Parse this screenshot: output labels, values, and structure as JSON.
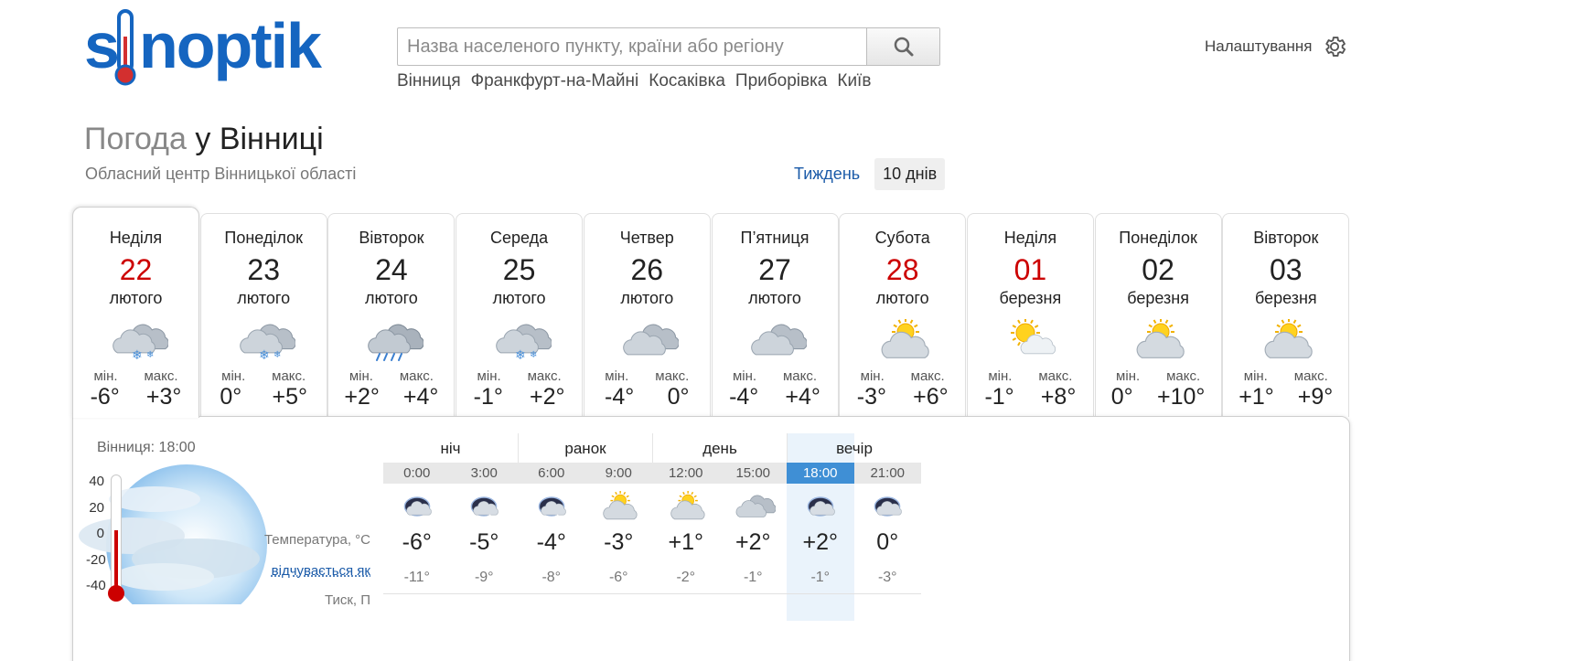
{
  "logo": {
    "text": "sinoptik"
  },
  "search": {
    "placeholder": "Назва населеного пункту, країни або регіону"
  },
  "quick_links": [
    "Вінниця",
    "Франкфурт-на-Майні",
    "Косаківка",
    "Приборівка",
    "Київ"
  ],
  "settings": {
    "label": "Налаштування"
  },
  "header": {
    "title_prefix": "Погода",
    "title_city": "у Вінниці",
    "subtitle": "Обласний центр Вінницької області"
  },
  "period": {
    "week": "Тиждень",
    "ten_days": "10 днів"
  },
  "labels": {
    "min": "мін.",
    "max": "макс."
  },
  "days": [
    {
      "name": "Неділя",
      "date": "22",
      "month": "лютого",
      "red": true,
      "icon": "cloud-snow-icon",
      "min": "-6°",
      "max": "+3°",
      "active": true
    },
    {
      "name": "Понеділок",
      "date": "23",
      "month": "лютого",
      "red": false,
      "icon": "cloud-snow-icon",
      "min": "0°",
      "max": "+5°"
    },
    {
      "name": "Вівторок",
      "date": "24",
      "month": "лютого",
      "red": false,
      "icon": "cloud-rain-icon",
      "min": "+2°",
      "max": "+4°"
    },
    {
      "name": "Середа",
      "date": "25",
      "month": "лютого",
      "red": false,
      "icon": "cloud-snow-icon",
      "min": "-1°",
      "max": "+2°"
    },
    {
      "name": "Четвер",
      "date": "26",
      "month": "лютого",
      "red": false,
      "icon": "cloud-icon",
      "min": "-4°",
      "max": "0°"
    },
    {
      "name": "П’ятниця",
      "date": "27",
      "month": "лютого",
      "red": false,
      "icon": "cloud-icon",
      "min": "-4°",
      "max": "+4°"
    },
    {
      "name": "Субота",
      "date": "28",
      "month": "лютого",
      "red": true,
      "icon": "sun-cloud-icon",
      "min": "-3°",
      "max": "+6°"
    },
    {
      "name": "Неділя",
      "date": "01",
      "month": "березня",
      "red": true,
      "icon": "sun-light-cloud-icon",
      "min": "-1°",
      "max": "+8°"
    },
    {
      "name": "Понеділок",
      "date": "02",
      "month": "березня",
      "red": false,
      "icon": "sun-cloud-icon",
      "min": "0°",
      "max": "+10°"
    },
    {
      "name": "Вівторок",
      "date": "03",
      "month": "березня",
      "red": false,
      "icon": "sun-cloud-icon",
      "min": "+1°",
      "max": "+9°"
    }
  ],
  "detail": {
    "now_label": "Вінниця: 18:00",
    "thermo_scale": [
      "40",
      "20",
      "0",
      "-20",
      "-40"
    ],
    "row_labels": {
      "temperature": "Температура, °C",
      "feels": "відчувається як",
      "pressure": "Тиск, П"
    },
    "parts": [
      "ніч",
      "ранок",
      "день",
      "вечір"
    ],
    "times": [
      "0:00",
      "3:00",
      "6:00",
      "9:00",
      "12:00",
      "15:00",
      "18:00",
      "21:00"
    ],
    "icons": [
      "night-cloud-icon",
      "night-cloud-snow-icon",
      "night-cloud-snow-icon",
      "sun-cloud-icon",
      "sun-cloud-icon",
      "cloud-icon",
      "night-cloud-icon",
      "night-cloud-icon"
    ],
    "temps": [
      "-6°",
      "-5°",
      "-4°",
      "-3°",
      "+1°",
      "+2°",
      "+2°",
      "0°"
    ],
    "feels": [
      "-11°",
      "-9°",
      "-8°",
      "-6°",
      "-2°",
      "-1°",
      "-1°",
      "-3°"
    ],
    "pressure": [
      "",
      "",
      "",
      "",
      "",
      "",
      "",
      ""
    ],
    "current_index": 6
  }
}
